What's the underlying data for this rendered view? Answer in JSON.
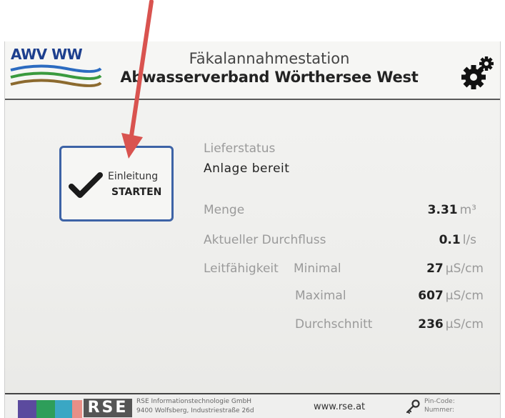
{
  "header": {
    "logo_text": "AWV WW",
    "title_line1": "Fäkalannahmestation",
    "title_line2": "Abwasserverband Wörthersee West",
    "settings_icon": "gear-icon"
  },
  "start_button": {
    "label_line1": "Einleitung",
    "label_line2": "STARTEN",
    "icon": "checkmark-icon"
  },
  "status": {
    "label": "Lieferstatus",
    "value": "Anlage bereit"
  },
  "metrics": {
    "menge": {
      "label": "Menge",
      "value": "3.31",
      "unit": "m³"
    },
    "durchfluss": {
      "label": "Aktueller Durchfluss",
      "value": "0.1",
      "unit": "l/s"
    },
    "leitfaehigkeit_label": "Leitfähigkeit",
    "minimal": {
      "label": "Minimal",
      "value": "27",
      "unit": "µS/cm"
    },
    "maximal": {
      "label": "Maximal",
      "value": "607",
      "unit": "µS/cm"
    },
    "durchschnitt": {
      "label": "Durchschnitt",
      "value": "236",
      "unit": "µS/cm"
    }
  },
  "footer": {
    "brand": "RSE",
    "company_line1": "RSE Informationstechnologie GmbH",
    "company_line2": "9400 Wolfsberg, Industriestraße 26d",
    "website": "www.rse.at",
    "pin_label_line1": "Pin-Code:",
    "pin_label_line2": "Nummer:",
    "color_squares": [
      "#5b4a9e",
      "#2e9e5a",
      "#3aa7c4",
      "#e88f87"
    ]
  },
  "annotation": {
    "arrow_color": "#d9534f"
  }
}
